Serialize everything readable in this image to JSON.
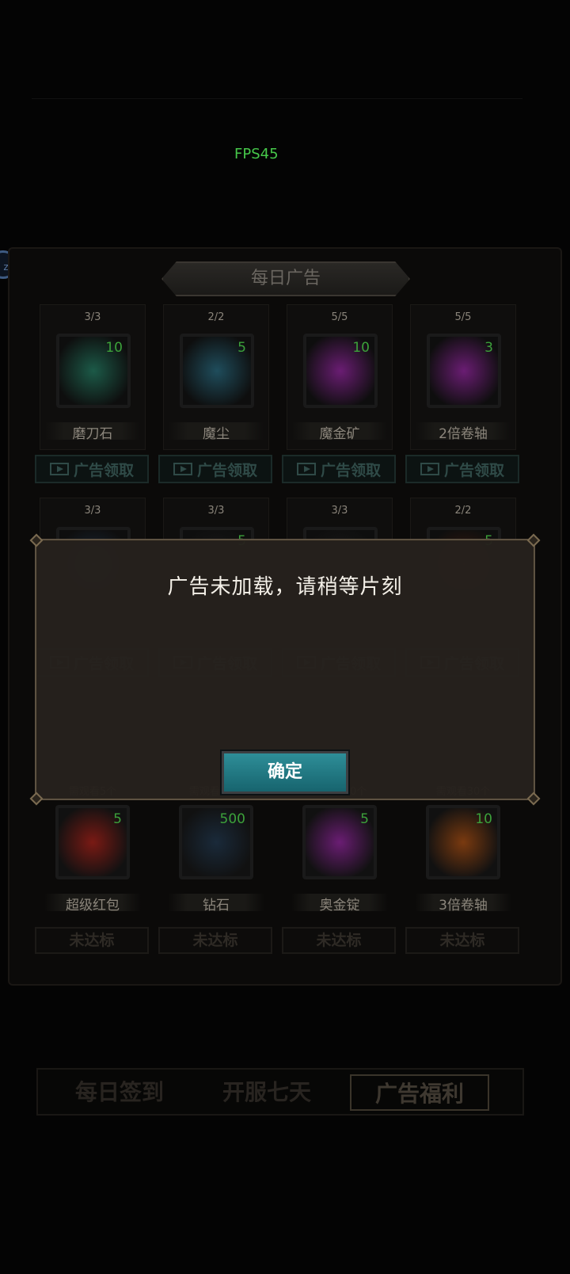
{
  "hud": {
    "fps": "FPS45"
  },
  "panel": {
    "title": "每日广告",
    "ad_items": [
      {
        "count": "3/3",
        "qty": "10",
        "name": "磨刀石",
        "icon": "whetstone-icon",
        "rarity_color": "#1c5a48"
      },
      {
        "count": "2/2",
        "qty": "5",
        "name": "魔尘",
        "icon": "magic-dust-icon",
        "rarity_color": "#1f4d5c"
      },
      {
        "count": "5/5",
        "qty": "10",
        "name": "魔金矿",
        "icon": "magic-ore-icon",
        "rarity_color": "#6a1d73"
      },
      {
        "count": "5/5",
        "qty": "3",
        "name": "2倍卷轴",
        "icon": "scroll-icon",
        "rarity_color": "#6a1d73"
      },
      {
        "count": "3/3",
        "qty": "",
        "name": "",
        "icon": "blue-stone-icon",
        "rarity_color": "#1a2a3a"
      },
      {
        "count": "3/3",
        "qty": "5",
        "name": "",
        "icon": "item-icon",
        "rarity_color": "#1a1a1a"
      },
      {
        "count": "3/3",
        "qty": "",
        "name": "",
        "icon": "item-icon",
        "rarity_color": "#1a1a1a"
      },
      {
        "count": "2/2",
        "qty": "5",
        "name": "",
        "icon": "red-envelope-icon",
        "rarity_color": "#3a1a10"
      }
    ],
    "ad_button_label": "广告领取",
    "milestones": [
      {
        "requirement": "需观看5个",
        "qty": "5",
        "name": "超级红包",
        "icon": "super-red-envelope-icon",
        "rarity_color": "#7a1a14"
      },
      {
        "requirement": "需观看12个",
        "qty": "500",
        "name": "钻石",
        "icon": "diamond-icon",
        "rarity_color": "#1a2a3a"
      },
      {
        "requirement": "需观看20个",
        "qty": "5",
        "name": "奥金锭",
        "icon": "ingot-icon",
        "rarity_color": "#6a1d73"
      },
      {
        "requirement": "需观看30个",
        "qty": "10",
        "name": "3倍卷轴",
        "icon": "scroll-icon",
        "rarity_color": "#7a3a10"
      }
    ],
    "locked_label": "未达标"
  },
  "tabs": [
    {
      "label": "每日签到",
      "active": false
    },
    {
      "label": "开服七天",
      "active": false
    },
    {
      "label": "广告福利",
      "active": true
    }
  ],
  "dialog": {
    "message": "广告未加载，请稍等片刻",
    "confirm_label": "确定"
  }
}
